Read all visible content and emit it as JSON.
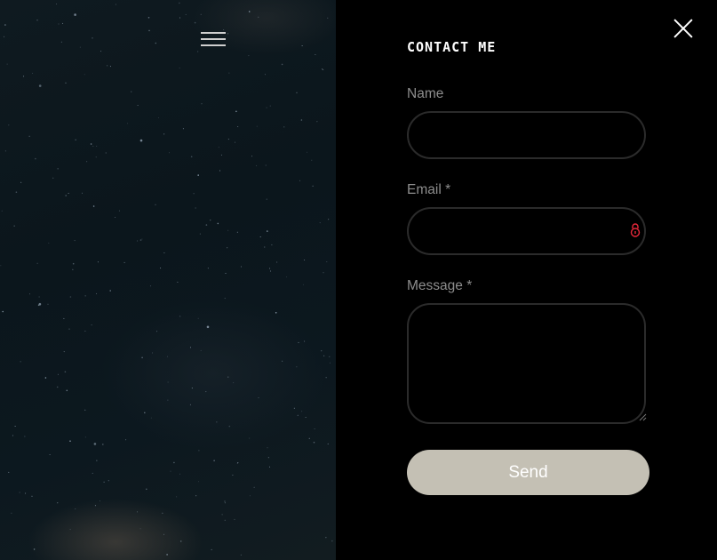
{
  "header": {
    "menu_icon": "hamburger-menu-icon",
    "close_icon": "close-icon"
  },
  "form": {
    "title": "CONTACT ME",
    "name_label": "Name",
    "email_label": "Email *",
    "message_label": "Message *",
    "name_value": "",
    "email_value": "",
    "message_value": "",
    "email_icon": "lock-icon",
    "send_label": "Send"
  },
  "colors": {
    "panel_background": "#000000",
    "field_border": "#2b2b2b",
    "label_text": "#8d8d8d",
    "send_button": "#c4c0b4",
    "lock_icon": "#e8283a"
  }
}
